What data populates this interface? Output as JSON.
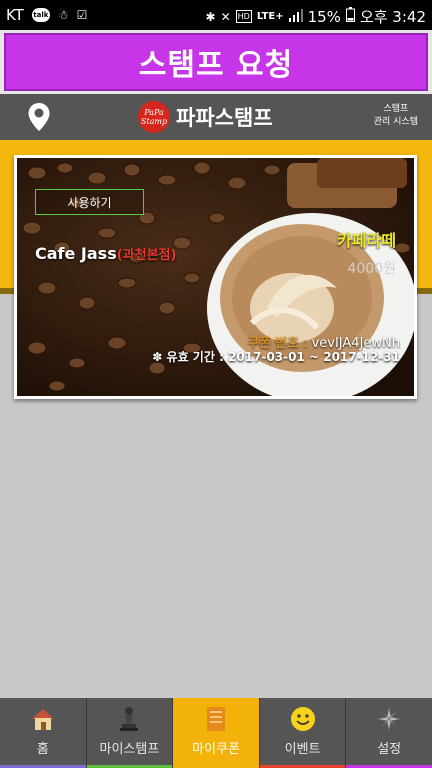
{
  "status_bar": {
    "carrier": "KT",
    "talk_label": "talk",
    "battery": "15%",
    "time": "오후 3:42",
    "lte": "LTE+",
    "hd": "HD"
  },
  "title": "스탬프 요청",
  "header": {
    "brand_name": "파파스탬프",
    "logo_text_1": "PaPa",
    "logo_text_2": "Stamp",
    "system_line1": "스탬프",
    "system_line2": "관리 시스템"
  },
  "coupon": {
    "use_button": "사용하기",
    "store_name": "Cafe Jass",
    "branch": "(과천본점)",
    "menu_name": "카페라떼",
    "price": "4000원",
    "coupon_number_label": "쿠폰 번호 :",
    "coupon_number": "vevIJA4JewNh",
    "validity_label": "유효 기간 :",
    "validity": "2017-03-01 ~ 2017-12-31"
  },
  "nav": {
    "items": [
      {
        "label": "홈",
        "icon": "home-icon",
        "underline": "#7d6bd8"
      },
      {
        "label": "마이스탬프",
        "icon": "chess-pawn-icon",
        "underline": "#5fbf3a"
      },
      {
        "label": "마이쿠폰",
        "icon": "notebook-icon",
        "underline": "#f2b20a"
      },
      {
        "label": "이벤트",
        "icon": "smiley-icon",
        "underline": "#e8432c"
      },
      {
        "label": "설정",
        "icon": "star-compass-icon",
        "underline": "#c636e8"
      }
    ],
    "active_index": 2
  },
  "colors": {
    "title_bg": "#c636e8",
    "header_bg": "#555555",
    "accent_yellow": "#f4b80e",
    "branch_red": "#e8382c",
    "menu_yellow": "#f0e82a"
  }
}
